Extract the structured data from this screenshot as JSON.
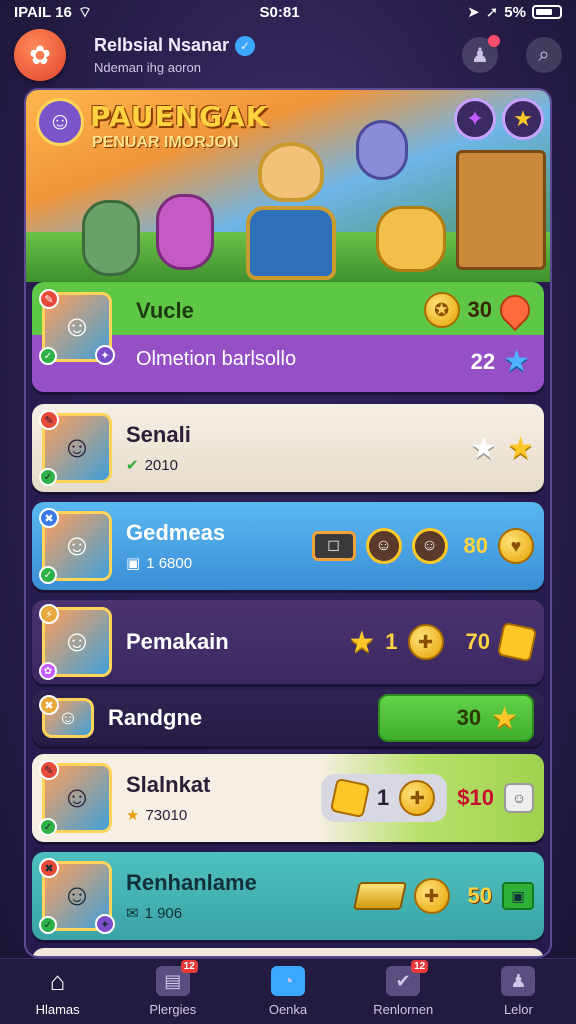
{
  "status": {
    "carrier": "IPAIL 16",
    "time": "S0:81",
    "battery": "5%"
  },
  "header": {
    "title": "Relbsial Nsanar",
    "subtitle": "Ndeman ihg aoron"
  },
  "banner": {
    "title": "PAUENGAK",
    "subtitle": "PENUAR IMORJON"
  },
  "rows": [
    {
      "name": "Vucle",
      "sub": "Olmetion barlsollo",
      "value_top": "30",
      "value_bottom": "22"
    },
    {
      "name": "Senali",
      "sub": "2010"
    },
    {
      "name": "Gedmeas",
      "sub": "1 6800",
      "value": "80"
    },
    {
      "name": "Pemakain",
      "value_a": "1",
      "value_b": "70"
    },
    {
      "name": "Randgne",
      "value": "30"
    },
    {
      "name": "Slalnkat",
      "sub": "73010",
      "value_a": "1",
      "value_b": "$10"
    },
    {
      "name": "Renhanlame",
      "sub": "1 906",
      "value": "50"
    }
  ],
  "nav": [
    {
      "label": "Hlamas",
      "icon": "home-icon"
    },
    {
      "label": "Plergies",
      "icon": "cards-icon",
      "badge": "12"
    },
    {
      "label": "Oenka",
      "icon": "alarm-icon"
    },
    {
      "label": "Renlornen",
      "icon": "checklist-icon",
      "badge": "12"
    },
    {
      "label": "Lelor",
      "icon": "profile-icon"
    }
  ],
  "colors": {
    "accent": "#ffc828",
    "background": "#2a1f4d",
    "green": "#5ec846",
    "purple": "#9550c6",
    "blue": "#3b8ed6",
    "teal": "#3ba3a6"
  }
}
